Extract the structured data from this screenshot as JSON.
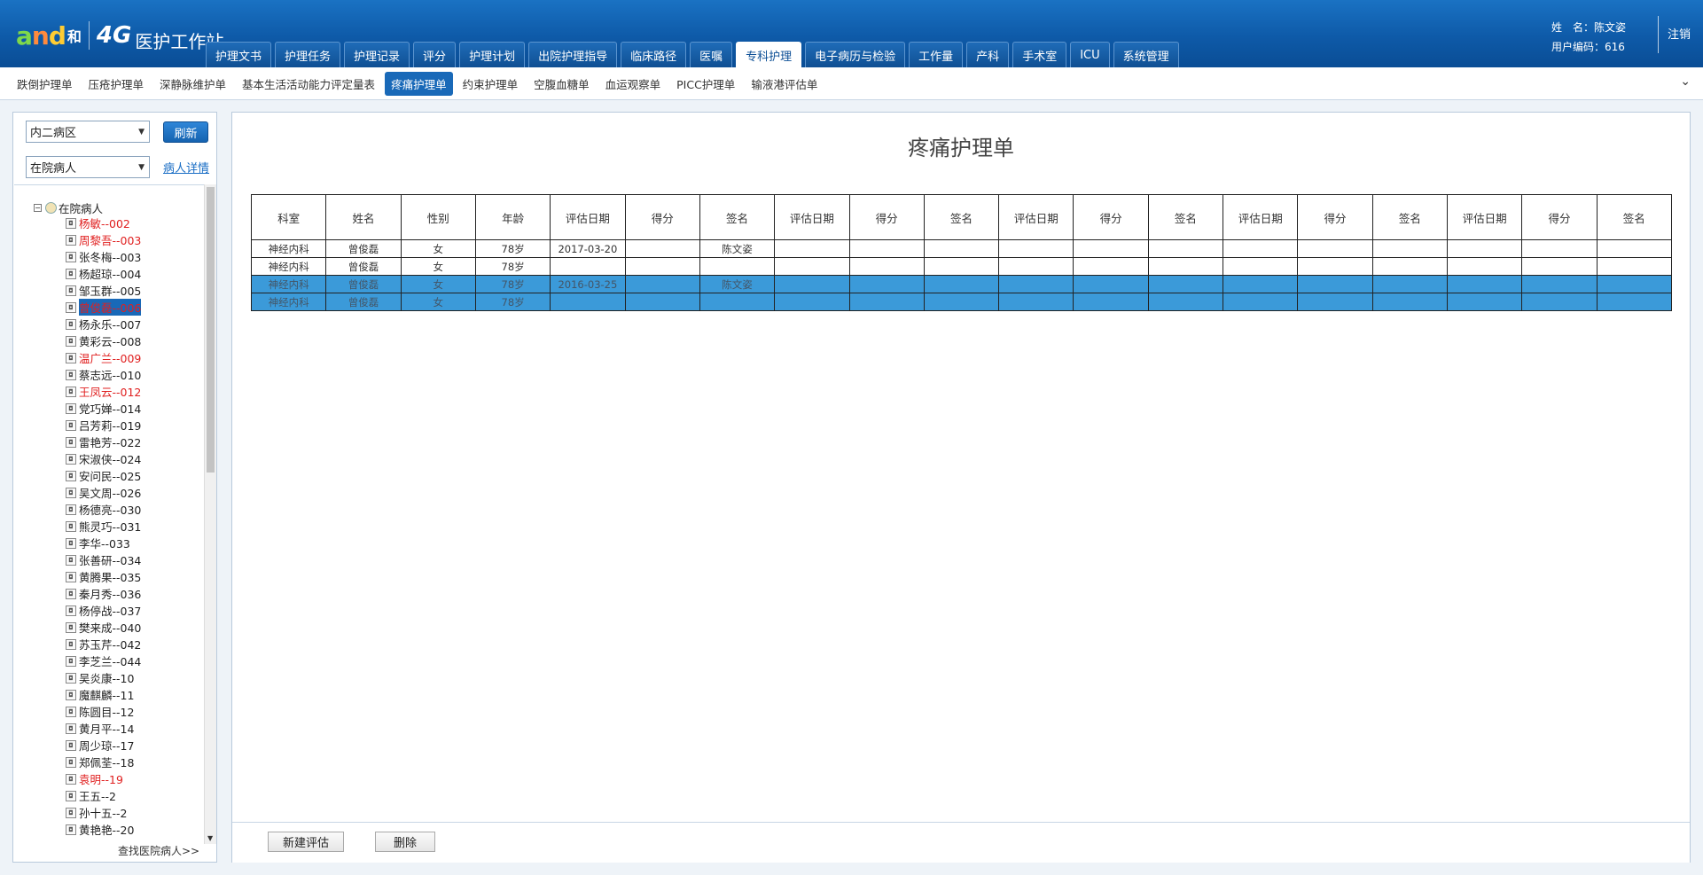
{
  "app": {
    "logo_and": "and",
    "logo_he": "和",
    "logo_4g": "4G",
    "title": "医护工作站"
  },
  "nav": {
    "tabs": [
      {
        "label": "护理文书"
      },
      {
        "label": "护理任务"
      },
      {
        "label": "护理记录"
      },
      {
        "label": "评分"
      },
      {
        "label": "护理计划"
      },
      {
        "label": "出院护理指导"
      },
      {
        "label": "临床路径"
      },
      {
        "label": "医嘱"
      },
      {
        "label": "专科护理",
        "active": true
      },
      {
        "label": "电子病历与检验"
      },
      {
        "label": "工作量"
      },
      {
        "label": "产科"
      },
      {
        "label": "手术室"
      },
      {
        "label": "ICU"
      },
      {
        "label": "系统管理"
      }
    ]
  },
  "user": {
    "name_line": "姓　名：陈文姿",
    "code_line": "用户编码：616",
    "logout": "注销"
  },
  "subnav": {
    "items": [
      {
        "label": "跌倒护理单"
      },
      {
        "label": "压疮护理单"
      },
      {
        "label": "深静脉维护单"
      },
      {
        "label": "基本生活活动能力评定量表"
      },
      {
        "label": "疼痛护理单",
        "active": true
      },
      {
        "label": "约束护理单"
      },
      {
        "label": "空腹血糖单"
      },
      {
        "label": "血运观察单"
      },
      {
        "label": "PICC护理单"
      },
      {
        "label": "输液港评估单"
      }
    ],
    "expand_icon": "chevron-down-icon"
  },
  "sidebar": {
    "ward_select": "内二病区",
    "refresh_label": "刷新",
    "patient_filter": "在院病人",
    "detail_link": "病人详情",
    "tree_root": "在院病人",
    "patients": [
      {
        "label": "杨敏--002",
        "red": true
      },
      {
        "label": "周黎吾--003",
        "red": true
      },
      {
        "label": "张冬梅--003"
      },
      {
        "label": "杨超琼--004"
      },
      {
        "label": "邹玉群--005"
      },
      {
        "label": "曾俊磊--006",
        "red": true,
        "selected": true
      },
      {
        "label": "杨永乐--007"
      },
      {
        "label": "黄彩云--008"
      },
      {
        "label": "温广兰--009",
        "red": true
      },
      {
        "label": "蔡志远--010"
      },
      {
        "label": "王凤云--012",
        "red": true
      },
      {
        "label": "党巧婵--014"
      },
      {
        "label": "吕芳莉--019"
      },
      {
        "label": "雷艳芳--022"
      },
      {
        "label": "宋淑侠--024"
      },
      {
        "label": "安问民--025"
      },
      {
        "label": "吴文周--026"
      },
      {
        "label": "杨德亮--030"
      },
      {
        "label": "熊灵巧--031"
      },
      {
        "label": "李华--033"
      },
      {
        "label": "张善研--034"
      },
      {
        "label": "黄腾果--035"
      },
      {
        "label": "秦月秀--036"
      },
      {
        "label": "杨停战--037"
      },
      {
        "label": "樊来成--040"
      },
      {
        "label": "苏玉芹--042"
      },
      {
        "label": "李芝兰--044"
      },
      {
        "label": "吴炎康--10"
      },
      {
        "label": "魔麒麟--11"
      },
      {
        "label": "陈圆目--12"
      },
      {
        "label": "黄月平--14"
      },
      {
        "label": "周少琼--17"
      },
      {
        "label": "郑佩荃--18"
      },
      {
        "label": "袁明--19",
        "red": true
      },
      {
        "label": "王五--2"
      },
      {
        "label": "孙十五--2"
      },
      {
        "label": "黄艳艳--20"
      }
    ],
    "find_link": "查找医院病人>>"
  },
  "main": {
    "title": "疼痛护理单",
    "columns": [
      "科室",
      "姓名",
      "性别",
      "年龄",
      "评估日期",
      "得分",
      "签名",
      "评估日期",
      "得分",
      "签名",
      "评估日期",
      "得分",
      "签名",
      "评估日期",
      "得分",
      "签名",
      "评估日期",
      "得分",
      "签名"
    ],
    "rows": [
      {
        "cells": [
          "神经内科",
          "曾俊磊",
          "女",
          "78岁",
          "2017-03-20",
          "",
          "陈文姿",
          "",
          "",
          "",
          "",
          "",
          "",
          "",
          "",
          "",
          "",
          "",
          ""
        ],
        "highlight": false
      },
      {
        "cells": [
          "神经内科",
          "曾俊磊",
          "女",
          "78岁",
          "",
          "",
          "",
          "",
          "",
          "",
          "",
          "",
          "",
          "",
          "",
          "",
          "",
          "",
          ""
        ],
        "highlight": false
      },
      {
        "cells": [
          "神经内科",
          "曾俊磊",
          "女",
          "78岁",
          "2016-03-25",
          "",
          "陈文姿",
          "",
          "",
          "",
          "",
          "",
          "",
          "",
          "",
          "",
          "",
          "",
          ""
        ],
        "highlight": true
      },
      {
        "cells": [
          "神经内科",
          "曾俊磊",
          "女",
          "78岁",
          "",
          "",
          "",
          "",
          "",
          "",
          "",
          "",
          "",
          "",
          "",
          "",
          "",
          "",
          ""
        ],
        "highlight": true
      }
    ],
    "new_button": "新建评估",
    "delete_button": "删除"
  }
}
